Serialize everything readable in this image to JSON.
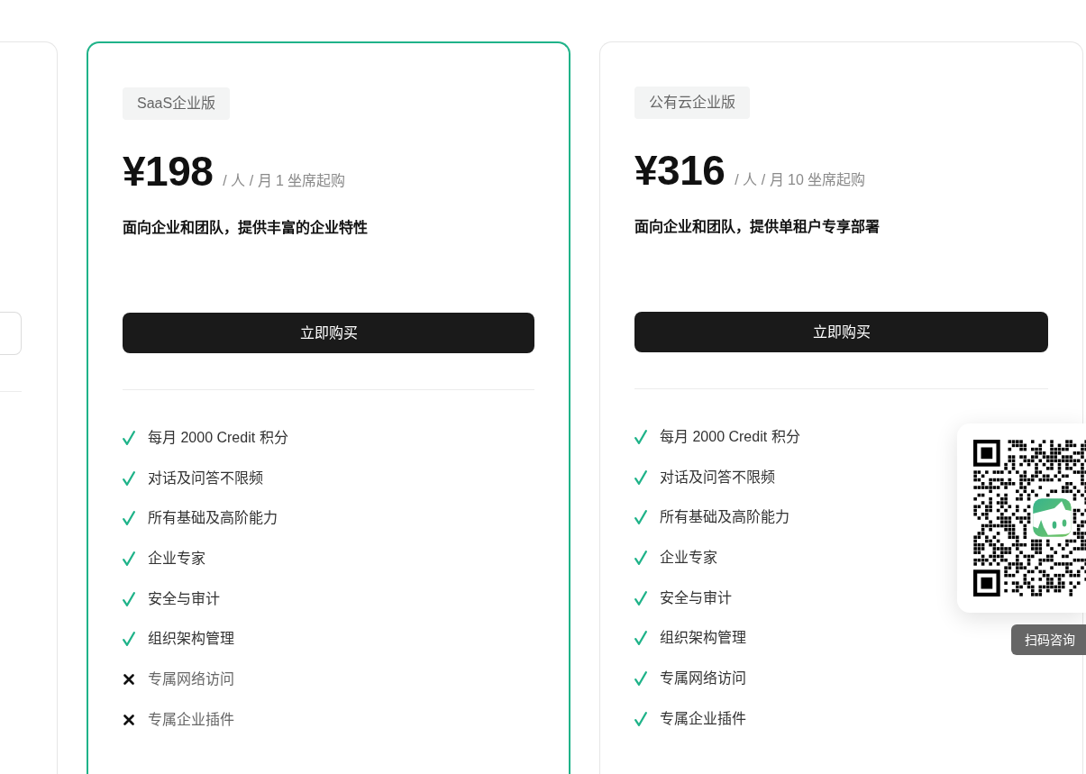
{
  "plans": [
    {
      "kind": "partial",
      "highlighted": false
    },
    {
      "kind": "full",
      "highlighted": true,
      "badge": "SaaS企业版",
      "price": "¥198",
      "price_note": "/ 人 / 月 1 坐席起购",
      "description": "面向企业和团队，提供丰富的企业特性",
      "button_label": "立即购买",
      "features": [
        {
          "text": "每月 2000 Credit 积分",
          "included": true
        },
        {
          "text": "对话及问答不限频",
          "included": true
        },
        {
          "text": "所有基础及高阶能力",
          "included": true
        },
        {
          "text": "企业专家",
          "included": true
        },
        {
          "text": "安全与审计",
          "included": true
        },
        {
          "text": "组织架构管理",
          "included": true
        },
        {
          "text": "专属网络访问",
          "included": false
        },
        {
          "text": "专属企业插件",
          "included": false
        }
      ]
    },
    {
      "kind": "full",
      "highlighted": false,
      "badge": "公有云企业版",
      "price": "¥316",
      "price_note": "/ 人 / 月 10 坐席起购",
      "description": "面向企业和团队，提供单租户专享部署",
      "button_label": "立即购买",
      "features": [
        {
          "text": "每月 2000 Credit 积分",
          "included": true
        },
        {
          "text": "对话及问答不限频",
          "included": true
        },
        {
          "text": "所有基础及高阶能力",
          "included": true
        },
        {
          "text": "企业专家",
          "included": true
        },
        {
          "text": "安全与审计",
          "included": true
        },
        {
          "text": "组织架构管理",
          "included": true
        },
        {
          "text": "专属网络访问",
          "included": true
        },
        {
          "text": "专属企业插件",
          "included": true
        }
      ]
    }
  ],
  "qr_popup": {
    "caption": "扫码咨询"
  }
}
